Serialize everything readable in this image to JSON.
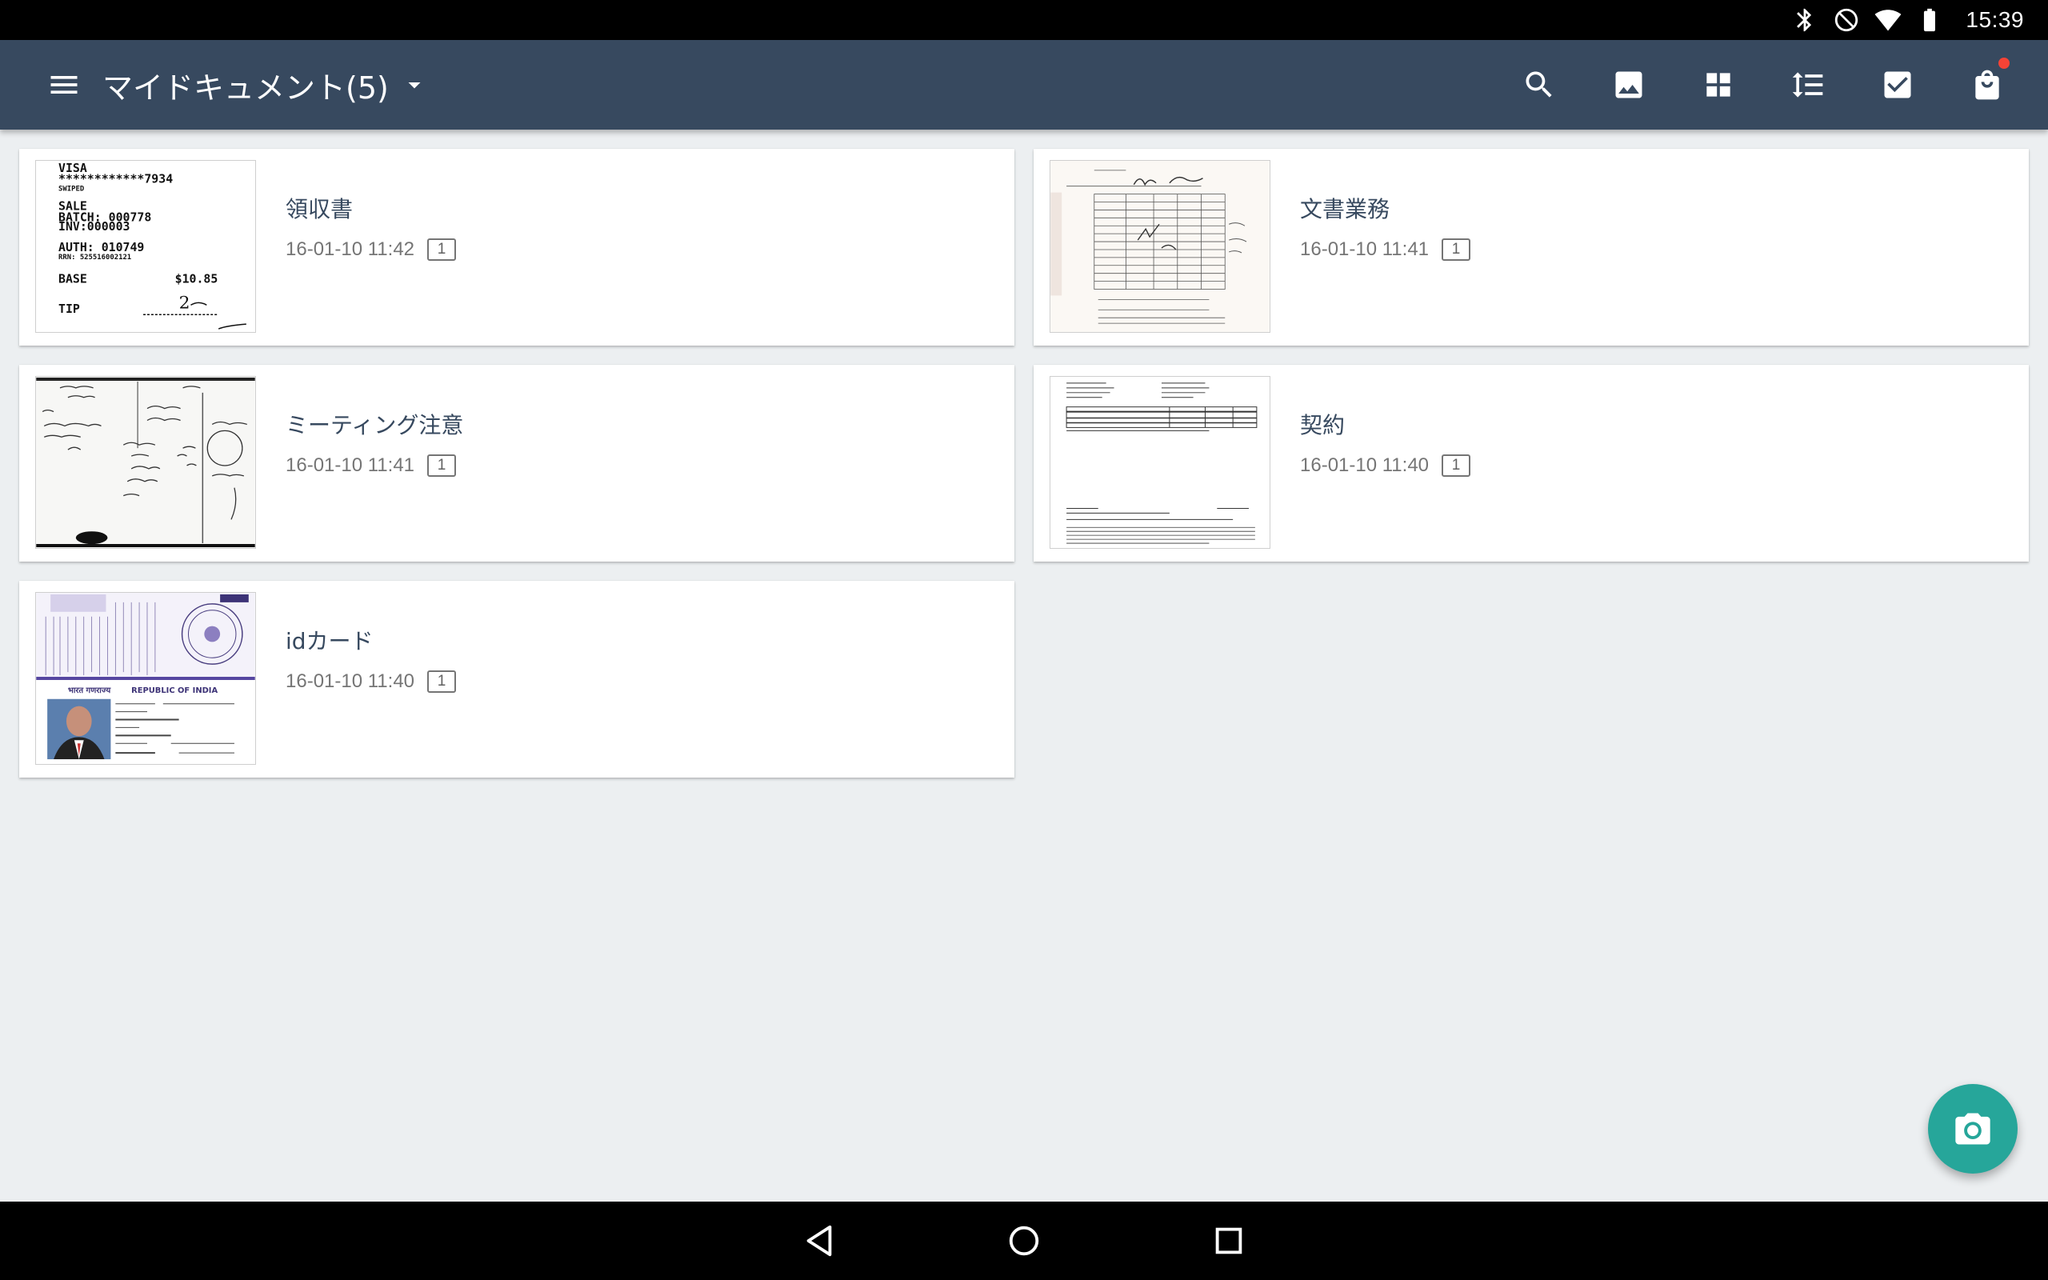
{
  "status_bar": {
    "time": "15:39",
    "icons": [
      "bluetooth-icon",
      "do-not-disturb-icon",
      "wifi-icon",
      "battery-icon"
    ]
  },
  "app_bar": {
    "title": "マイドキュメント(5)",
    "background": "#37495F",
    "actions": [
      "search-icon",
      "image-icon",
      "grid-view-icon",
      "sort-icon",
      "select-icon",
      "store-icon"
    ]
  },
  "documents": [
    {
      "title": "領収書",
      "date": "16-01-10 11:42",
      "pages": "1",
      "thumb_icon": "receipt-thumbnail"
    },
    {
      "title": "文書業務",
      "date": "16-01-10 11:41",
      "pages": "1",
      "thumb_icon": "form-thumbnail"
    },
    {
      "title": "ミーティング注意",
      "date": "16-01-10 11:41",
      "pages": "1",
      "thumb_icon": "whiteboard-thumbnail"
    },
    {
      "title": "契約",
      "date": "16-01-10 11:40",
      "pages": "1",
      "thumb_icon": "contract-thumbnail"
    },
    {
      "title": "idカード",
      "date": "16-01-10 11:40",
      "pages": "1",
      "thumb_icon": "id-card-thumbnail"
    }
  ],
  "thumbnail_text": {
    "receipt": {
      "card": "VISA",
      "number": "************7934",
      "swiped": "SWIPED",
      "sale": "SALE",
      "batch": "BATCH: 000778",
      "inv": "INV:000003",
      "auth": "AUTH: 010749",
      "rrn": "RRN: 525516002121",
      "base_label": "BASE",
      "base_value": "$10.85",
      "tip_label": "TIP",
      "tip_value": "2"
    },
    "id_card": {
      "republic": "REPUBLIC OF INDIA"
    }
  },
  "fab": {
    "icon": "camera-icon",
    "color": "#26A69A"
  },
  "nav_bar": {
    "icons": [
      "back-icon",
      "home-icon",
      "recents-icon"
    ]
  }
}
